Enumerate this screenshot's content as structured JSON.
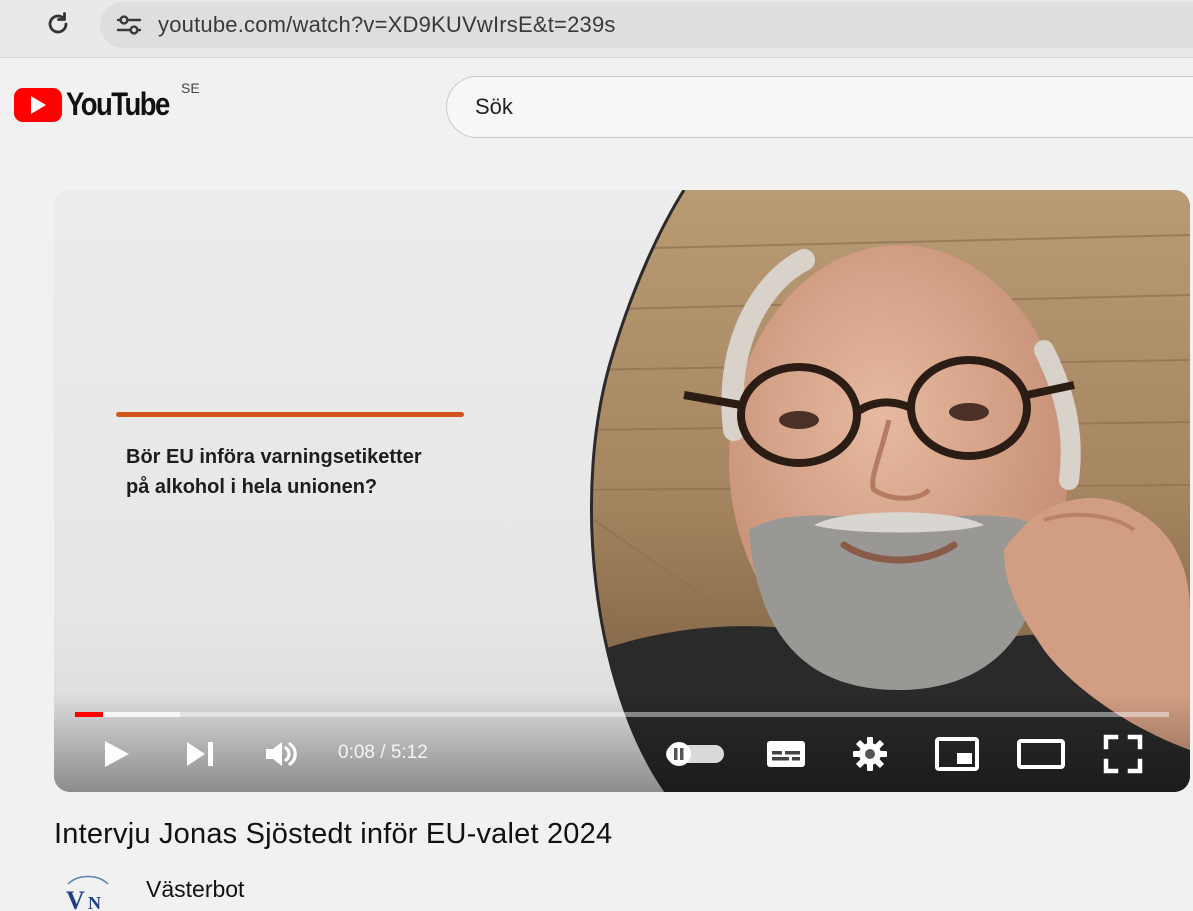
{
  "browser": {
    "url": "youtube.com/watch?v=XD9KUVwIrsE&t=239s"
  },
  "header": {
    "logo_text": "YouTube",
    "country_code": "SE",
    "search_placeholder": "Sök"
  },
  "player": {
    "slide_question_line1": "Bör EU införa varningsetiketter",
    "slide_question_line2": "på alkohol i hela unionen?",
    "time_current": "0:08",
    "time_separator": " / ",
    "time_total": "5:12",
    "progress_fraction": 0.026,
    "buffer_fraction": 0.096,
    "accent_color": "#d2541f",
    "progress_color": "#ff0000"
  },
  "video": {
    "title": "Intervju Jonas Sjöstedt inför EU-valet 2024",
    "channel_name": "Västerbot"
  },
  "icons": {
    "reload": "reload-icon",
    "site_settings": "site-settings-icon",
    "play": "play-icon",
    "next": "next-icon",
    "volume": "volume-icon",
    "autoplay": "autoplay-toggle-icon",
    "subtitles": "subtitles-icon",
    "settings": "settings-gear-icon",
    "miniplayer": "miniplayer-icon",
    "theater": "theater-mode-icon",
    "fullscreen": "fullscreen-icon"
  }
}
